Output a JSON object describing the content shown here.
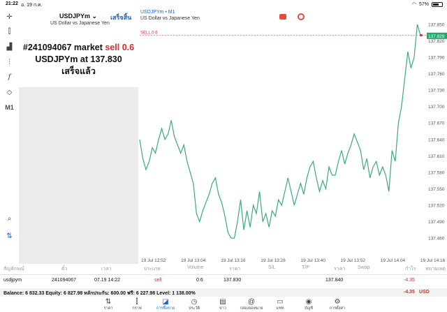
{
  "status_bar": {
    "time": "21:22",
    "date": "อ. 19 ก.ค.",
    "battery": "57%"
  },
  "left_toolbar": {
    "timeframe": "M1"
  },
  "order_panel": {
    "symbol": "USDJPYm",
    "description": "US Dollar vs Japanese Yen",
    "done_label": "เสร็จสิ้น",
    "result_line1_prefix": "#241094067 market ",
    "result_line1_side": "sell 0.6",
    "result_line2_prefix": "USDJPYm at ",
    "result_line2_price": "137.830",
    "result_line3": "เสร็จแล้ว"
  },
  "chart_header": {
    "symbol": "USDJPYm • M1",
    "description": "US Dollar vs Japanese Yen",
    "sell_label": "SELL 0.6"
  },
  "chart_data": {
    "type": "line",
    "title": "",
    "xlabel": "",
    "ylabel": "",
    "ylim": [
      137.445,
      137.865
    ],
    "y_ticks": [
      "137.850",
      "137.820",
      "137.790",
      "137.760",
      "137.730",
      "137.700",
      "137.670",
      "137.640",
      "137.610",
      "137.580",
      "137.550",
      "137.520",
      "137.490",
      "137.460"
    ],
    "x_ticks": [
      "19 Jul 12:52",
      "19 Jul 13:04",
      "19 Jul 13:16",
      "19 Jul 13:28",
      "19 Jul 13:40",
      "19 Jul 13:52",
      "19 Jul 14:04",
      "19 Jul 14:16"
    ],
    "current_price": "137.829",
    "sell_level": 137.83,
    "series": [
      {
        "values": [
          137.64,
          137.605,
          137.585,
          137.6,
          137.625,
          137.615,
          137.64,
          137.66,
          137.64,
          137.65,
          137.675,
          137.645,
          137.63,
          137.615,
          137.63,
          137.6,
          137.58,
          137.56,
          137.505,
          137.49,
          137.51,
          137.525,
          137.54,
          137.56,
          137.57,
          137.54,
          137.525,
          137.5,
          137.47,
          137.46,
          137.46,
          137.49,
          137.53,
          137.475,
          137.51,
          137.48,
          137.52,
          137.505,
          137.545,
          137.49,
          137.505,
          137.48,
          137.51,
          137.5,
          137.53,
          137.52,
          137.545,
          137.57,
          137.545,
          137.52,
          137.54,
          137.56,
          137.54,
          137.57,
          137.59,
          137.6,
          137.57,
          137.545,
          137.565,
          137.55,
          137.59,
          137.575,
          137.575,
          137.6,
          137.62,
          137.595,
          137.615,
          137.63,
          137.65,
          137.635,
          137.62,
          137.585,
          137.605,
          137.57,
          137.59,
          137.6,
          137.575,
          137.59,
          137.575,
          137.545,
          137.62,
          137.6,
          137.67,
          137.7,
          137.75,
          137.8,
          137.77,
          137.79,
          137.85,
          137.83
        ]
      }
    ]
  },
  "table": {
    "headers": [
      "สัญลักษณ์",
      "ตั๋ว",
      "เวลา",
      "ประเภท",
      "Volume",
      "ราคา",
      "S/L",
      "T/P",
      "ราคา",
      "Swap",
      "กำไร",
      "หมายเหตุ"
    ],
    "row": {
      "symbol": "usdjpym",
      "ticket": "241094067",
      "time": "07.19 14:22",
      "type": "sell",
      "volume": "0.6",
      "price": "137.830",
      "current_price": "137.840",
      "profit": "-4.35"
    },
    "balance": "Balance: 6 832.33 Equity: 6 827.98 หลักประกัน: 600.00 ฟรี: 6 227.98 Level: 1 138.00%",
    "total_profit": "-4.35",
    "currency": "USD"
  },
  "bottom_nav": {
    "items": [
      {
        "label": "ราคา",
        "icon": "arrows-updown-icon"
      },
      {
        "label": "กราฟ",
        "icon": "candles-icon"
      },
      {
        "label": "การซื้อขาย",
        "icon": "trade-chart-icon"
      },
      {
        "label": "ประวัติ",
        "icon": "history-icon"
      },
      {
        "label": "ข่าว",
        "icon": "news-icon"
      },
      {
        "label": "กล่องจดหมาย",
        "icon": "mail-at-icon"
      },
      {
        "label": "แชท",
        "icon": "chat-icon"
      },
      {
        "label": "บัญชี",
        "icon": "account-icon"
      },
      {
        "label": "การตั้งค่า",
        "icon": "gear-icon"
      }
    ],
    "active_index": 2
  },
  "colors": {
    "accent": "#1565d8",
    "line": "#3aaa7e",
    "sell": "#d32f2f",
    "price_tag": "#22a86b"
  }
}
